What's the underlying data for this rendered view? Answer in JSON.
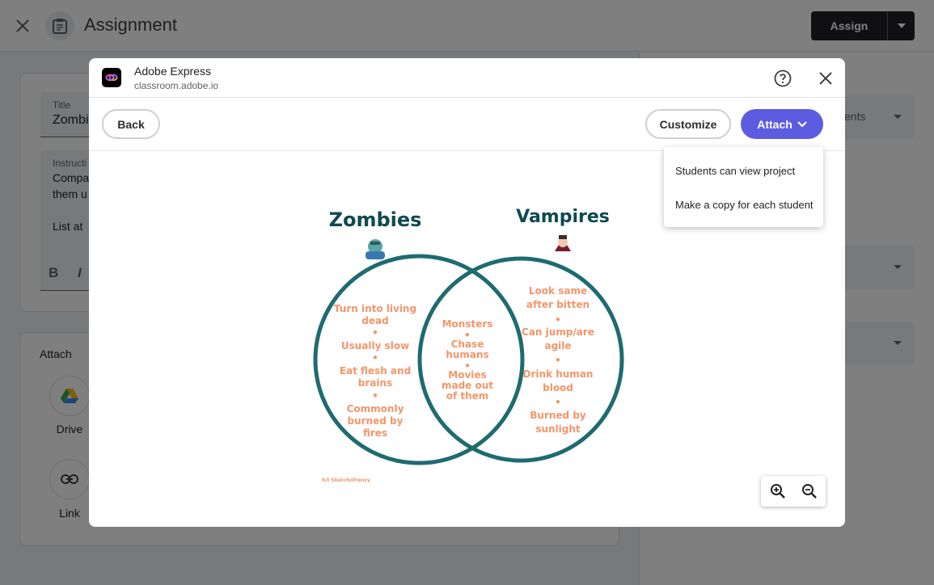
{
  "background": {
    "page_title": "Assignment",
    "assign_label": "Assign",
    "title_field": {
      "label": "Title",
      "value": "Zombi"
    },
    "instructions_field": {
      "label": "Instructi",
      "lines": [
        "Compa",
        "them u",
        "List at"
      ]
    },
    "format": {
      "bold": "B",
      "italic": "I"
    },
    "attach": {
      "label": "Attach",
      "items": [
        {
          "label": "Drive"
        },
        {
          "label": "Link"
        }
      ]
    },
    "side_partial_text": "ents"
  },
  "dialog": {
    "app_name": "Adobe Express",
    "app_url": "classroom.adobe.io",
    "back_label": "Back",
    "customize_label": "Customize",
    "attach_label": "Attach",
    "menu_items": [
      "Students can view project",
      "Make a copy for each student"
    ]
  },
  "venn": {
    "left_title": "Zombies",
    "right_title": "Vampires",
    "left_items": [
      "Turn into living dead",
      "Usually slow",
      "Eat flesh and brains",
      "Commonly burned by fires"
    ],
    "middle_items": [
      "Monsters",
      "Chase humans",
      "Movies made out of them"
    ],
    "right_items": [
      "Look same after bitten",
      "Can jump/are agile",
      "Drink human blood",
      "Burned by sunlight"
    ],
    "credit": "h/t Sketchofrenzy",
    "colors": {
      "circle": "#1e6b70",
      "text": "#f4956a",
      "title": "#0e4a4f"
    }
  },
  "icons": {
    "close": "close-icon",
    "help": "help-icon",
    "zoom_in": "zoom-in-icon",
    "zoom_out": "zoom-out-icon"
  }
}
